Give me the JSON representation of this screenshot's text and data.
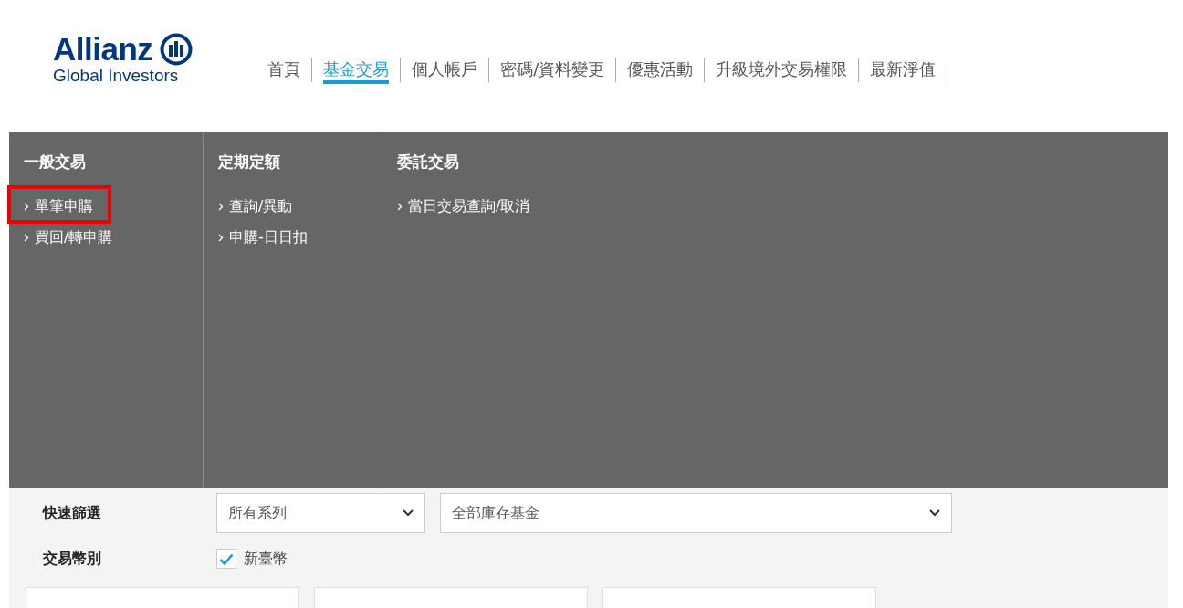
{
  "logo": {
    "brand": "Allianz",
    "subtitle": "Global Investors"
  },
  "nav": [
    {
      "label": "首頁",
      "selected": false
    },
    {
      "label": "基金交易",
      "selected": true
    },
    {
      "label": "個人帳戶",
      "selected": false
    },
    {
      "label": "密碼/資料變更",
      "selected": false
    },
    {
      "label": "優惠活動",
      "selected": false
    },
    {
      "label": "升級境外交易權限",
      "selected": false
    },
    {
      "label": "最新淨值",
      "selected": false
    }
  ],
  "menu": [
    {
      "title": "一般交易",
      "items": [
        {
          "label": "單筆申購",
          "highlighted": true
        },
        {
          "label": "買回/轉申購",
          "highlighted": false
        }
      ]
    },
    {
      "title": "定期定額",
      "items": [
        {
          "label": "查詢/異動",
          "highlighted": false
        },
        {
          "label": "申購-日日扣",
          "highlighted": false
        }
      ]
    },
    {
      "title": "委託交易",
      "items": [
        {
          "label": "當日交易查詢/取消",
          "highlighted": false
        }
      ]
    }
  ],
  "filters": {
    "quick_filter": {
      "label": "快速篩選",
      "series_select": "所有系列",
      "fund_select": "全部庫存基金"
    },
    "currency": {
      "label": "交易幣別",
      "option": "新臺幣",
      "checked": true
    }
  },
  "bottom_fields": [
    {
      "kind": "field"
    },
    {
      "kind": "field"
    },
    {
      "kind": "field"
    }
  ]
}
